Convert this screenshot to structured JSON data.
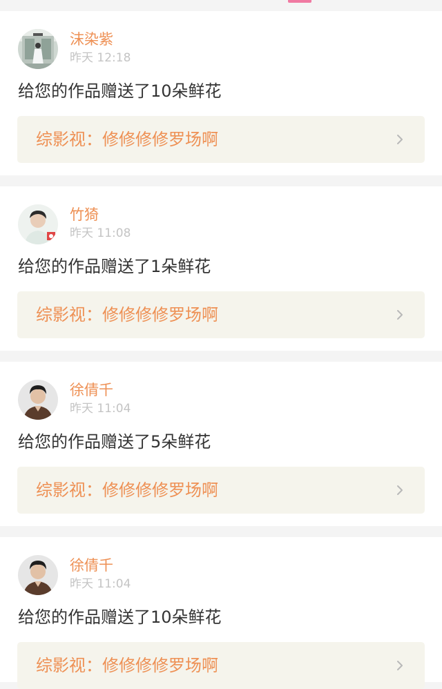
{
  "notifications": [
    {
      "username": "沫染紫",
      "time": "昨天 12:18",
      "message": "给您的作品赠送了10朵鲜花",
      "work": "综影视：修修修修罗场啊",
      "avatar_icon": "avatar-photo-woman-white-dress"
    },
    {
      "username": "竹猗",
      "time": "昨天 11:08",
      "message": "给您的作品赠送了1朵鲜花",
      "work": "综影视：修修修修罗场啊",
      "avatar_icon": "avatar-photo-man-light"
    },
    {
      "username": "徐倩千",
      "time": "昨天 11:04",
      "message": "给您的作品赠送了5朵鲜花",
      "work": "综影视：修修修修罗场啊",
      "avatar_icon": "avatar-photo-man-dark"
    },
    {
      "username": "徐倩千",
      "time": "昨天 11:04",
      "message": "给您的作品赠送了10朵鲜花",
      "work": "综影视：修修修修罗场啊",
      "avatar_icon": "avatar-photo-man-dark"
    }
  ],
  "colors": {
    "accent": "#ee9054",
    "tab_indicator": "#f07aa2",
    "link_background": "#f5f4ec",
    "timestamp": "#c4c4c4",
    "message": "#333333"
  }
}
